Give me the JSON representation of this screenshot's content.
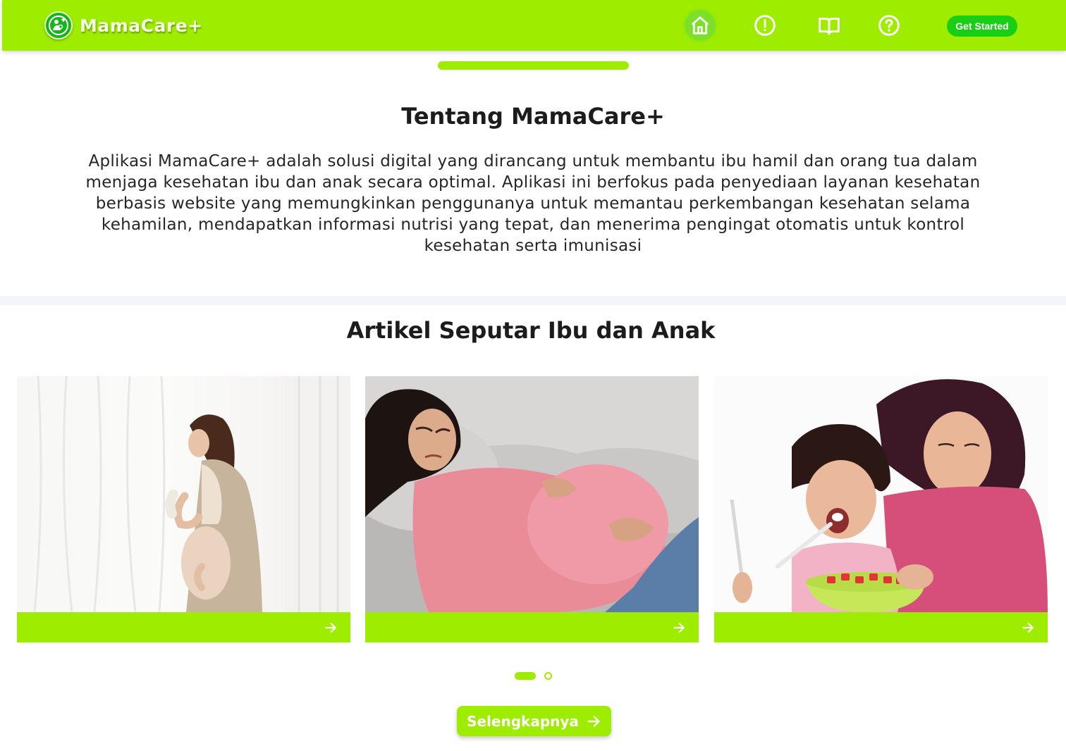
{
  "colors": {
    "brand_green": "#9eec00",
    "cta_green": "#18cf16",
    "divider": "#f3f5fb"
  },
  "header": {
    "brand": "MamaCare+",
    "logo_icon": "mother-baby-logo-icon",
    "nav": [
      {
        "icon": "home-icon",
        "active": true
      },
      {
        "icon": "alert-circle-icon",
        "active": false
      },
      {
        "icon": "open-book-icon",
        "active": false
      },
      {
        "icon": "help-circle-icon",
        "active": false
      }
    ],
    "cta_label": "Get Started"
  },
  "about": {
    "title": "Tentang MamaCare+",
    "text": "Aplikasi MamaCare+ adalah solusi digital yang dirancang untuk membantu ibu hamil dan orang tua dalam menjaga kesehatan ibu dan anak secara optimal. Aplikasi ini berfokus pada penyediaan layanan kesehatan berbasis website yang memungkinkan penggunanya untuk memantau perkembangan kesehatan selama kehamilan, mendapatkan informasi nutrisi yang tepat, dan menerima pengingat otomatis untuk kontrol kesehatan serta imunisasi"
  },
  "articles": {
    "title": "Artikel Seputar Ibu dan Anak",
    "cards": [
      {
        "image": "pregnant-woman-by-window-photo",
        "arrow": "arrow-right-icon"
      },
      {
        "image": "pregnant-woman-in-pain-on-sofa-photo",
        "arrow": "arrow-right-icon"
      },
      {
        "image": "mother-and-daughter-eating-photo",
        "arrow": "arrow-right-icon"
      }
    ],
    "pagination": {
      "pages": 2,
      "current": 1
    },
    "more_label": "Selengkapnya"
  }
}
